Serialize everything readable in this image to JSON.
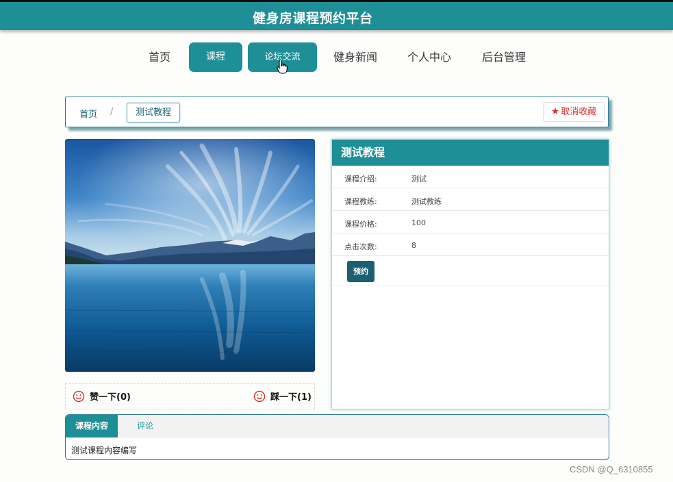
{
  "header": {
    "title": "健身房课程预约平台"
  },
  "nav": {
    "items": [
      {
        "label": "首页"
      },
      {
        "label": "课程"
      },
      {
        "label": "论坛交流"
      },
      {
        "label": "健身新闻"
      },
      {
        "label": "个人中心"
      },
      {
        "label": "后台管理"
      }
    ],
    "accent_color": "#1f8f97"
  },
  "breadcrumb": {
    "home": "首页",
    "separator": "/",
    "current": "测试教程",
    "favorite_label": "取消收藏"
  },
  "photo": {
    "description_icon": "landscape-image"
  },
  "votes": {
    "like_label": "赞一下(0)",
    "dislike_label": "踩一下(1)"
  },
  "course": {
    "title": "测试教程",
    "rows": [
      {
        "label": "课程介绍:",
        "value": "测试"
      },
      {
        "label": "课程教练:",
        "value": "测试教练"
      },
      {
        "label": "课程价格:",
        "value": "100"
      },
      {
        "label": "点击次数:",
        "value": "8"
      }
    ],
    "book_label": "预约"
  },
  "tabs": {
    "items": [
      {
        "label": "课程内容"
      },
      {
        "label": "评论"
      }
    ],
    "content": "测试课程内容编写"
  },
  "watermark": "CSDN @Q_6310855"
}
